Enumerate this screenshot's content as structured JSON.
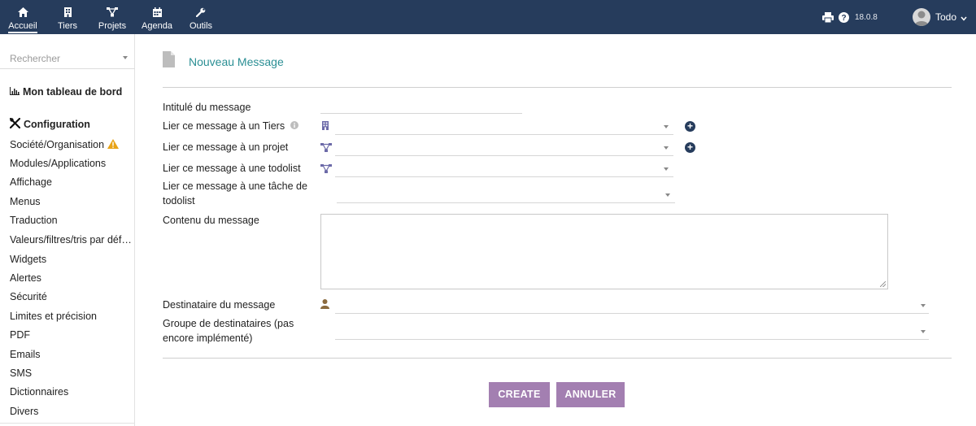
{
  "topbar": {
    "menus": [
      {
        "label": "Accueil",
        "icon": "home-icon"
      },
      {
        "label": "Tiers",
        "icon": "building-icon"
      },
      {
        "label": "Projets",
        "icon": "project-icon"
      },
      {
        "label": "Agenda",
        "icon": "calendar-icon"
      },
      {
        "label": "Outils",
        "icon": "wrench-icon"
      }
    ],
    "version": "18.0.8",
    "user": "Todo",
    "background": "#263c5c"
  },
  "sidebar": {
    "search_placeholder": "Rechercher",
    "dashboard_title": "Mon tableau de bord",
    "config_title": "Configuration",
    "items": [
      "Société/Organisation",
      "Modules/Applications",
      "Affichage",
      "Menus",
      "Traduction",
      "Valeurs/filtres/tris par défaut",
      "Widgets",
      "Alertes",
      "Sécurité",
      "Limites et précision",
      "PDF",
      "Emails",
      "SMS",
      "Dictionnaires",
      "Divers"
    ]
  },
  "form": {
    "title": "Nouveau Message",
    "title_color": "#2b8f94",
    "fields": {
      "subject": "Intitulé du message",
      "link_tiers": "Lier ce message à un Tiers",
      "link_project": "Lier ce message à un projet",
      "link_todolist": "Lier ce message à une todolist",
      "link_task": "Lier ce message à une tâche de todolist",
      "content": "Contenu du message",
      "recipient": "Destinataire du message",
      "group": "Groupe de destinataires (pas encore implémenté)"
    },
    "buttons": {
      "create": "CREATE",
      "cancel": "ANNULER",
      "color": "#a37fb1"
    }
  }
}
